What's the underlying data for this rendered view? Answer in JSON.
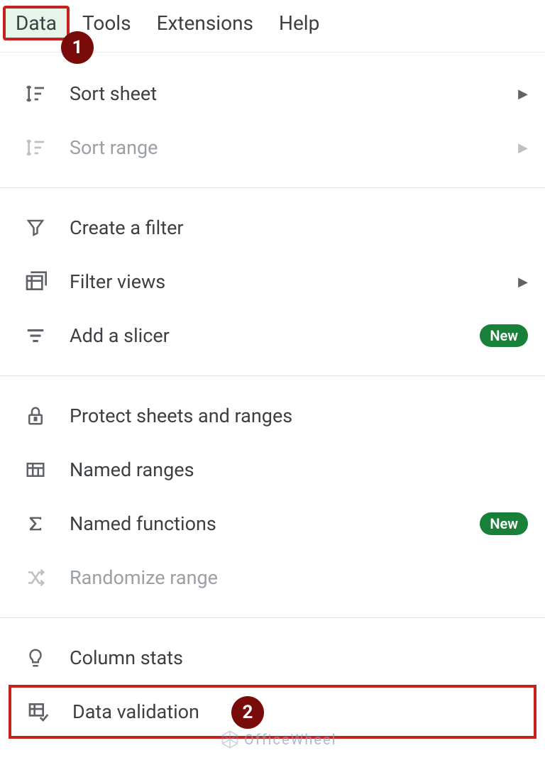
{
  "menubar": {
    "items": [
      {
        "label": "Data",
        "active": true
      },
      {
        "label": "Tools"
      },
      {
        "label": "Extensions"
      },
      {
        "label": "Help"
      }
    ]
  },
  "annotations": {
    "badge1": "1",
    "badge2": "2"
  },
  "menu": {
    "sort_sheet": "Sort sheet",
    "sort_range": "Sort range",
    "create_filter": "Create a filter",
    "filter_views": "Filter views",
    "add_slicer": "Add a slicer",
    "protect": "Protect sheets and ranges",
    "named_ranges": "Named ranges",
    "named_functions": "Named functions",
    "randomize": "Randomize range",
    "column_stats": "Column stats",
    "data_validation": "Data validation"
  },
  "badges": {
    "new": "New"
  },
  "watermark": "OfficeWheel"
}
